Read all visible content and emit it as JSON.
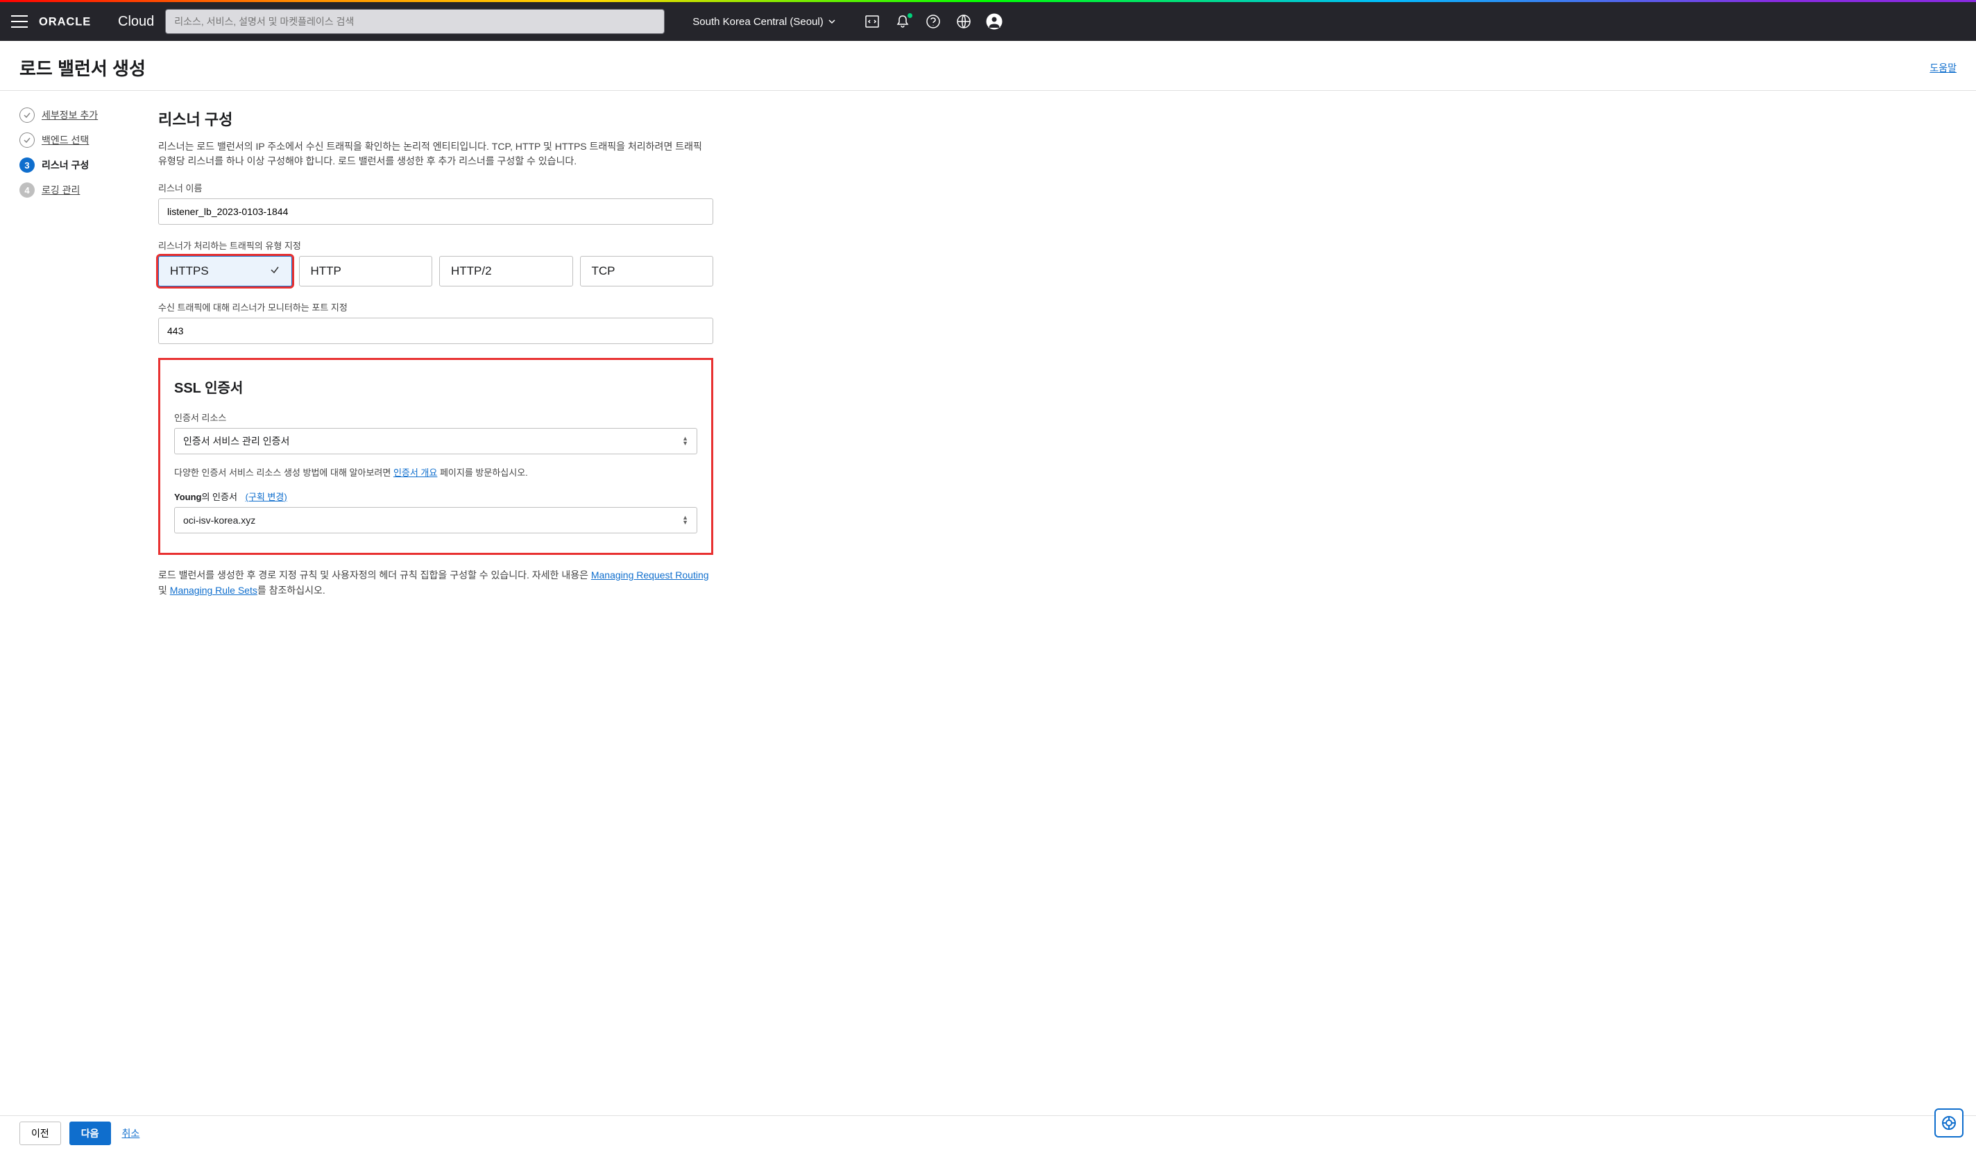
{
  "nav": {
    "logo": "ORACLE",
    "logo_suffix": "Cloud",
    "search_placeholder": "리소스, 서비스, 설명서 및 마켓플레이스 검색",
    "region": "South Korea Central (Seoul)"
  },
  "header": {
    "title": "로드 밸런서 생성",
    "help": "도움말"
  },
  "wizard": {
    "step1": "세부정보 추가",
    "step2": "백엔드 선택",
    "step3": "리스너 구성",
    "step4": "로깅 관리",
    "num3": "3",
    "num4": "4"
  },
  "main": {
    "section_title": "리스너 구성",
    "desc": "리스너는 로드 밸런서의 IP 주소에서 수신 트래픽을 확인하는 논리적 엔티티입니다. TCP, HTTP 및 HTTPS 트래픽을 처리하려면 트래픽 유형당 리스너를 하나 이상 구성해야 합니다. 로드 밸런서를 생성한 후 추가 리스너를 구성할 수 있습니다.",
    "listener_name_label": "리스너 이름",
    "listener_name_value": "listener_lb_2023-0103-1844",
    "traffic_label": "리스너가 처리하는 트래픽의 유형 지정",
    "traffic": {
      "https": "HTTPS",
      "http": "HTTP",
      "http2": "HTTP/2",
      "tcp": "TCP"
    },
    "port_label": "수신 트래픽에 대해 리스너가 모니터하는 포트 지정",
    "port_value": "443"
  },
  "ssl": {
    "title": "SSL 인증서",
    "resource_label": "인증서 리소스",
    "resource_value": "인증서 서비스 관리 인증서",
    "info_prefix": "다양한 인증서 서비스 리소스 생성 방법에 대해 알아보려면 ",
    "info_link": "인증서 개요",
    "info_suffix": " 페이지를 방문하십시오.",
    "young_bold": "Young",
    "young_text": "의 인증서",
    "young_link": "(구획 변경)",
    "cert_value": "oci-isv-korea.xyz"
  },
  "footer": {
    "text_prefix": "로드 밸런서를 생성한 후 경로 지정 규칙 및 사용자정의 헤더 규칙 집합을 구성할 수 있습니다. 자세한 내용은 ",
    "link1": "Managing Request Routing",
    "mid": " 및 ",
    "link2": "Managing Rule Sets",
    "suffix": "를 참조하십시오."
  },
  "buttons": {
    "prev": "이전",
    "next": "다음",
    "cancel": "취소"
  }
}
